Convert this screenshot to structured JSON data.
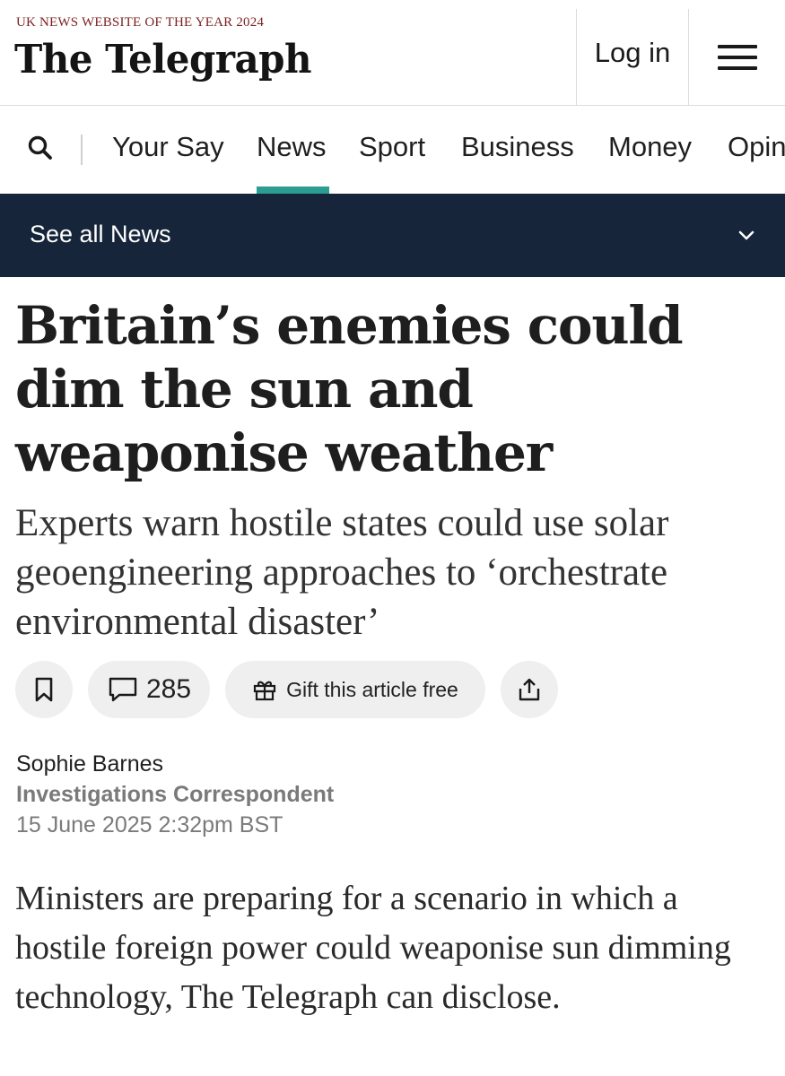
{
  "masthead": {
    "tagline": "UK NEWS WEBSITE OF THE YEAR 2024",
    "logo": "The Telegraph",
    "login_label": "Log in",
    "menu_icon": "hamburger-menu-icon"
  },
  "nav": {
    "search_icon": "search-icon",
    "items": [
      "Your Say",
      "News",
      "Sport",
      "Business",
      "Money",
      "Opin"
    ],
    "active_index": 1,
    "active_color": "#2b9e91"
  },
  "subbar": {
    "label": "See all News",
    "icon": "chevron-down-icon",
    "background": "#16253a"
  },
  "article": {
    "headline": "Britain’s enemies could dim the sun and weaponise weather",
    "standfirst": "Experts warn hostile states could use solar geoengineering approaches to ‘orchestrate environmental disaster’",
    "actions": {
      "bookmark_icon": "bookmark-icon",
      "comment_icon": "comment-icon",
      "comment_count": "285",
      "gift_icon": "gift-icon",
      "gift_label": "Gift this article free",
      "share_icon": "share-icon"
    },
    "byline": {
      "author": "Sophie Barnes",
      "role": "Investigations Correspondent",
      "date": "15 June 2025 2:32pm BST"
    },
    "body": "Ministers are preparing for a scenario in which a hostile foreign power could weaponise sun dimming technology, The Telegraph can disclose."
  }
}
